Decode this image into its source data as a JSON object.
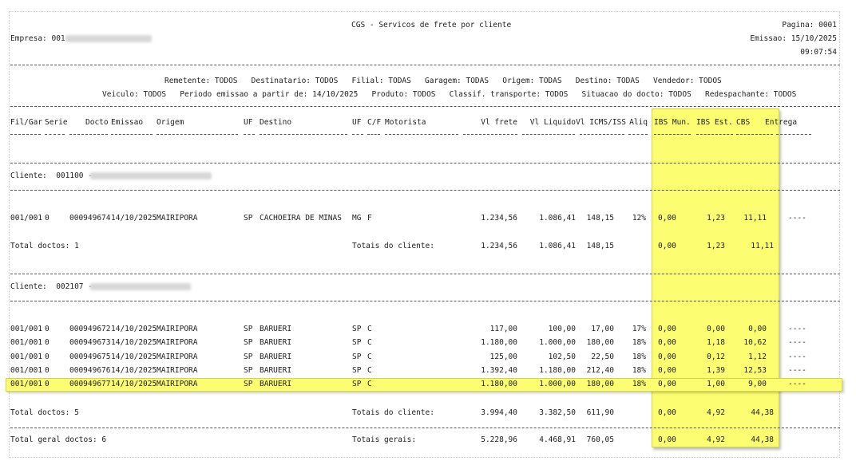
{
  "header": {
    "title": "CGS - Servicos de frete por cliente",
    "page_label": "Pagina: 0001",
    "company_label": "Empresa: 001",
    "emission_label": "Emissao: 15/10/2025",
    "time": "09:07:54"
  },
  "filters": {
    "line1": "Remetente: TODOS   Destinatario: TODOS   Filial: TODAS   Garagem: TODAS   Origem: TODAS   Destino: TODAS   Vendedor: TODOS",
    "line2": "Veiculo: TODOS   Periodo emissao a partir de: 14/10/2025   Produto: TODOS   Classif. transporte: TODOS   Situacao do docto: TODOS   Redespachante: TODOS"
  },
  "columns": {
    "filgar": "Fil/Gar",
    "serie": "Serie",
    "docto": "Docto",
    "emissao": "Emissao",
    "origem": "Origem",
    "uf_origem": "UF",
    "destino": "Destino",
    "uf_destino": "UF",
    "cf": "C/F",
    "motorista": "Motorista",
    "vl_frete": "Vl frete",
    "vl_liquido": "Vl Liquido",
    "vl_icms": "Vl ICMS/ISS",
    "aliq": "Aliq",
    "ibs_mun": "IBS Mun.",
    "ibs_est": "IBS Est.",
    "cbs": "CBS",
    "entrega": "Entrega"
  },
  "clients": [
    {
      "label": "Cliente:  001100 -",
      "rows": [
        {
          "filgar": "001/001",
          "serie": "0",
          "docto": "000949674",
          "emissao": "14/10/2025",
          "origem": "MAIRIPORA",
          "uf_origem": "SP",
          "destino": "CACHOEIRA DE MINAS",
          "uf_destino": "MG",
          "cf": "F",
          "vl_frete": "1.234,56",
          "vl_liquido": "1.086,41",
          "vl_icms": "148,15",
          "aliq": "12%",
          "ibs_mun": "0,00",
          "ibs_est": "1,23",
          "cbs": "11,11",
          "entrega": "----"
        }
      ],
      "total_doctos": "Total doctos: 1",
      "totals_label": "Totais do cliente:",
      "totals": {
        "vl_frete": "1.234,56",
        "vl_liquido": "1.086,41",
        "vl_icms": "148,15",
        "ibs_mun": "0,00",
        "ibs_est": "1,23",
        "cbs": "11,11"
      }
    },
    {
      "label": "Cliente:  002107 -",
      "rows": [
        {
          "filgar": "001/001",
          "serie": "0",
          "docto": "000949672",
          "emissao": "14/10/2025",
          "origem": "MAIRIPORA",
          "uf_origem": "SP",
          "destino": "BARUERI",
          "uf_destino": "SP",
          "cf": "C",
          "vl_frete": "117,00",
          "vl_liquido": "100,00",
          "vl_icms": "17,00",
          "aliq": "17%",
          "ibs_mun": "0,00",
          "ibs_est": "0,00",
          "cbs": "0,00",
          "entrega": "----"
        },
        {
          "filgar": "001/001",
          "serie": "0",
          "docto": "000949673",
          "emissao": "14/10/2025",
          "origem": "MAIRIPORA",
          "uf_origem": "SP",
          "destino": "BARUERI",
          "uf_destino": "SP",
          "cf": "C",
          "vl_frete": "1.180,00",
          "vl_liquido": "1.000,00",
          "vl_icms": "180,00",
          "aliq": "18%",
          "ibs_mun": "0,00",
          "ibs_est": "1,18",
          "cbs": "10,62",
          "entrega": "----"
        },
        {
          "filgar": "001/001",
          "serie": "0",
          "docto": "000949675",
          "emissao": "14/10/2025",
          "origem": "MAIRIPORA",
          "uf_origem": "SP",
          "destino": "BARUERI",
          "uf_destino": "SP",
          "cf": "C",
          "vl_frete": "125,00",
          "vl_liquido": "102,50",
          "vl_icms": "22,50",
          "aliq": "18%",
          "ibs_mun": "0,00",
          "ibs_est": "0,12",
          "cbs": "1,12",
          "entrega": "----"
        },
        {
          "filgar": "001/001",
          "serie": "0",
          "docto": "000949676",
          "emissao": "14/10/2025",
          "origem": "MAIRIPORA",
          "uf_origem": "SP",
          "destino": "BARUERI",
          "uf_destino": "SP",
          "cf": "C",
          "vl_frete": "1.392,40",
          "vl_liquido": "1.180,00",
          "vl_icms": "212,40",
          "aliq": "18%",
          "ibs_mun": "0,00",
          "ibs_est": "1,39",
          "cbs": "12,53",
          "entrega": "----"
        },
        {
          "filgar": "001/001",
          "serie": "0",
          "docto": "000949677",
          "emissao": "14/10/2025",
          "origem": "MAIRIPORA",
          "uf_origem": "SP",
          "destino": "BARUERI",
          "uf_destino": "SP",
          "cf": "C",
          "vl_frete": "1.180,00",
          "vl_liquido": "1.000,00",
          "vl_icms": "180,00",
          "aliq": "18%",
          "ibs_mun": "0,00",
          "ibs_est": "1,00",
          "cbs": "9,00",
          "entrega": "----"
        }
      ],
      "total_doctos": "Total doctos: 5",
      "totals_label": "Totais do cliente:",
      "totals": {
        "vl_frete": "3.994,40",
        "vl_liquido": "3.382,50",
        "vl_icms": "611,90",
        "ibs_mun": "0,00",
        "ibs_est": "4,92",
        "cbs": "44,38"
      }
    }
  ],
  "grand_total": {
    "total_doctos": "Total geral doctos: 6",
    "label": "Totais gerais:",
    "vl_frete": "5.228,96",
    "vl_liquido": "4.468,91",
    "vl_icms": "760,05",
    "ibs_mun": "0,00",
    "ibs_est": "4,92",
    "cbs": "44,38"
  },
  "colors": {
    "highlight": "#fdfd72",
    "highlight_border": "#d6d640",
    "text": "#222222"
  }
}
